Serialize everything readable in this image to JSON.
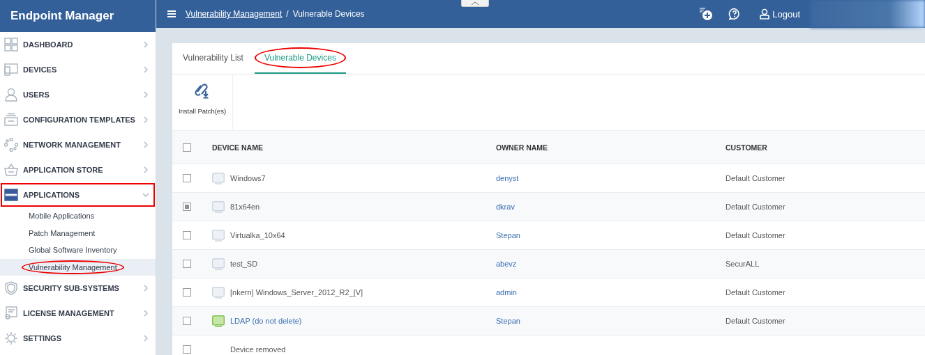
{
  "app_title": "Endpoint Manager",
  "sidebar": {
    "items": [
      {
        "label": "DASHBOARD",
        "expanded": false,
        "annotated": false
      },
      {
        "label": "DEVICES",
        "expanded": false,
        "annotated": false
      },
      {
        "label": "USERS",
        "expanded": false,
        "annotated": false
      },
      {
        "label": "CONFIGURATION TEMPLATES",
        "expanded": false,
        "annotated": false
      },
      {
        "label": "NETWORK MANAGEMENT",
        "expanded": false,
        "annotated": false
      },
      {
        "label": "APPLICATION STORE",
        "expanded": false,
        "annotated": false
      },
      {
        "label": "APPLICATIONS",
        "expanded": true,
        "annotated": true,
        "children": [
          {
            "label": "Mobile Applications",
            "selected": false,
            "annotated": false
          },
          {
            "label": "Patch Management",
            "selected": false,
            "annotated": false
          },
          {
            "label": "Global Software Inventory",
            "selected": false,
            "annotated": false
          },
          {
            "label": "Vulnerability Management",
            "selected": true,
            "annotated": true
          }
        ]
      },
      {
        "label": "SECURITY SUB-SYSTEMS",
        "expanded": false,
        "annotated": false
      },
      {
        "label": "LICENSE MANAGEMENT",
        "expanded": false,
        "annotated": false
      },
      {
        "label": "SETTINGS",
        "expanded": false,
        "annotated": false
      }
    ]
  },
  "header": {
    "breadcrumb_link": "Vulnerability Management",
    "separator": "/",
    "current": "Vulnerable Devices",
    "logout": "Logout"
  },
  "tabs": [
    {
      "label": "Vulnerability List",
      "selected": false,
      "annotated": false
    },
    {
      "label": "Vulnerable Devices",
      "selected": true,
      "annotated": true
    }
  ],
  "toolbar": [
    {
      "label": "Install Patch(es)"
    }
  ],
  "table": {
    "all_checked": false,
    "columns": [
      "DEVICE NAME",
      "OWNER NAME",
      "CUSTOMER"
    ],
    "rows": [
      {
        "checked": false,
        "kind": "offline",
        "device": "Windows7",
        "owner": "denyst",
        "customer": "Default Customer"
      },
      {
        "checked": true,
        "kind": "offline",
        "device": "81x64en",
        "owner": "dkrav",
        "customer": "Default Customer"
      },
      {
        "checked": false,
        "kind": "offline",
        "device": "Virtualka_10x64",
        "owner": "Stepan",
        "customer": "Default Customer"
      },
      {
        "checked": false,
        "kind": "offline",
        "device": "test_SD",
        "owner": "abevz",
        "customer": "SecurALL"
      },
      {
        "checked": false,
        "kind": "offline",
        "device": "[nkern] Windows_Server_2012_R2_[V]",
        "owner": "admin",
        "customer": "Default Customer"
      },
      {
        "checked": false,
        "kind": "online",
        "device": "LDAP (do not delete)",
        "owner": "Stepan",
        "customer": "Default Customer"
      },
      {
        "checked": false,
        "kind": "removed",
        "device": "Device removed"
      }
    ]
  }
}
